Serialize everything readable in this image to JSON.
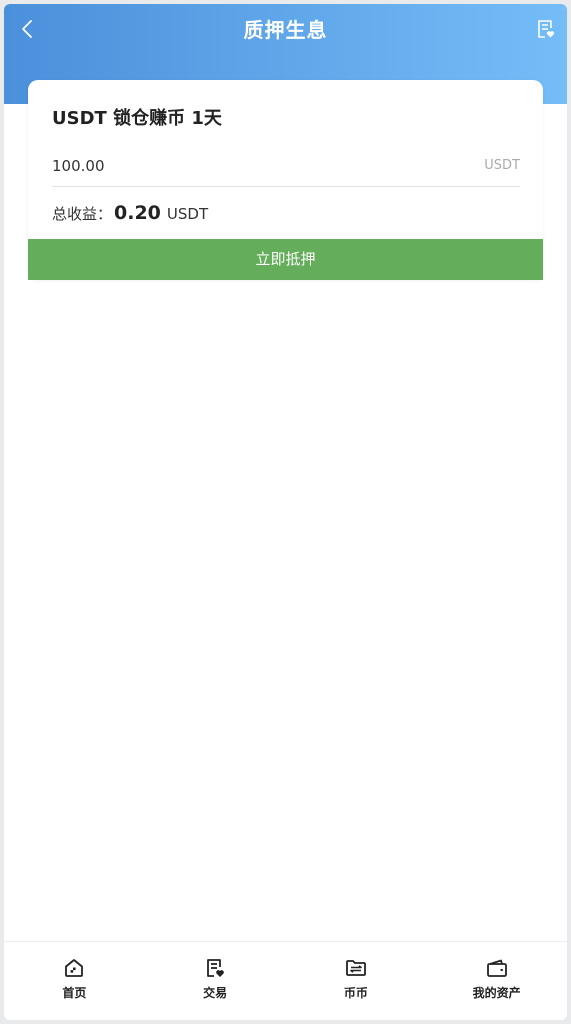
{
  "header": {
    "title": "质押生息",
    "back_icon": "chevron-left-icon",
    "record_icon": "record-list-icon",
    "gradient_start": "#4a90db",
    "gradient_end": "#75bdf8"
  },
  "card": {
    "title": "USDT 锁仓赚币 1天",
    "amount": {
      "value": "100.00",
      "unit": "USDT"
    },
    "income": {
      "label": "总收益：",
      "value": "0.20",
      "unit": "USDT"
    }
  },
  "stake_button": {
    "label": "立即抵押",
    "color": "#64ad5a"
  },
  "tabbar": {
    "items": [
      {
        "label": "首页",
        "icon": "home-icon"
      },
      {
        "label": "交易",
        "icon": "trade-icon"
      },
      {
        "label": "币币",
        "icon": "exchange-icon"
      },
      {
        "label": "我的资产",
        "icon": "wallet-icon"
      }
    ]
  }
}
